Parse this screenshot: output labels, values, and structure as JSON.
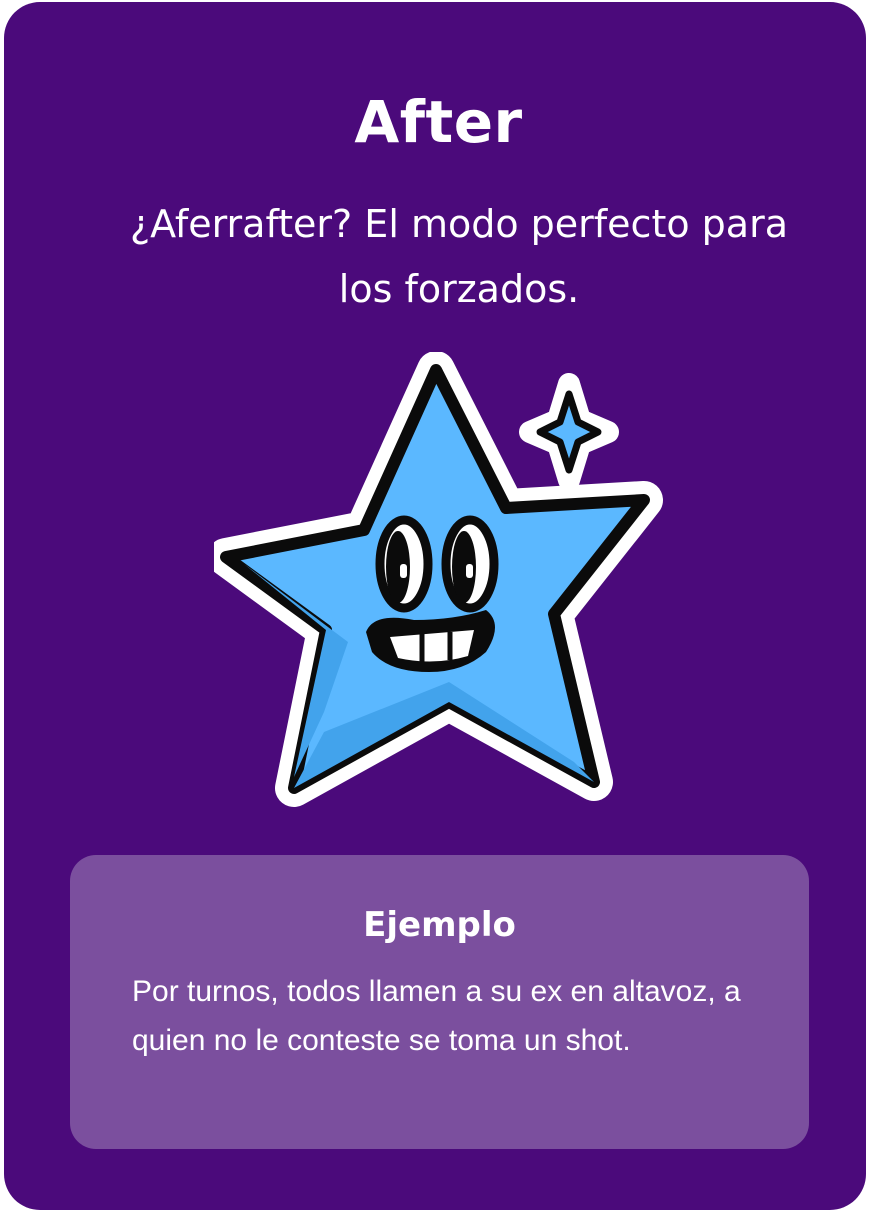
{
  "card": {
    "title": "After",
    "subtitle": "¿Aferrafter? El modo perfecto para los forzados.",
    "illustration": "smiling-star-icon"
  },
  "example": {
    "heading": "Ejemplo",
    "text": "Por turnos, todos llamen a su ex en altavoz, a quien no le conteste se toma un shot."
  },
  "colors": {
    "card_background": "#4b0a7b",
    "example_background": "#7b4f9e",
    "star_fill": "#5bb8ff",
    "text": "#ffffff"
  }
}
